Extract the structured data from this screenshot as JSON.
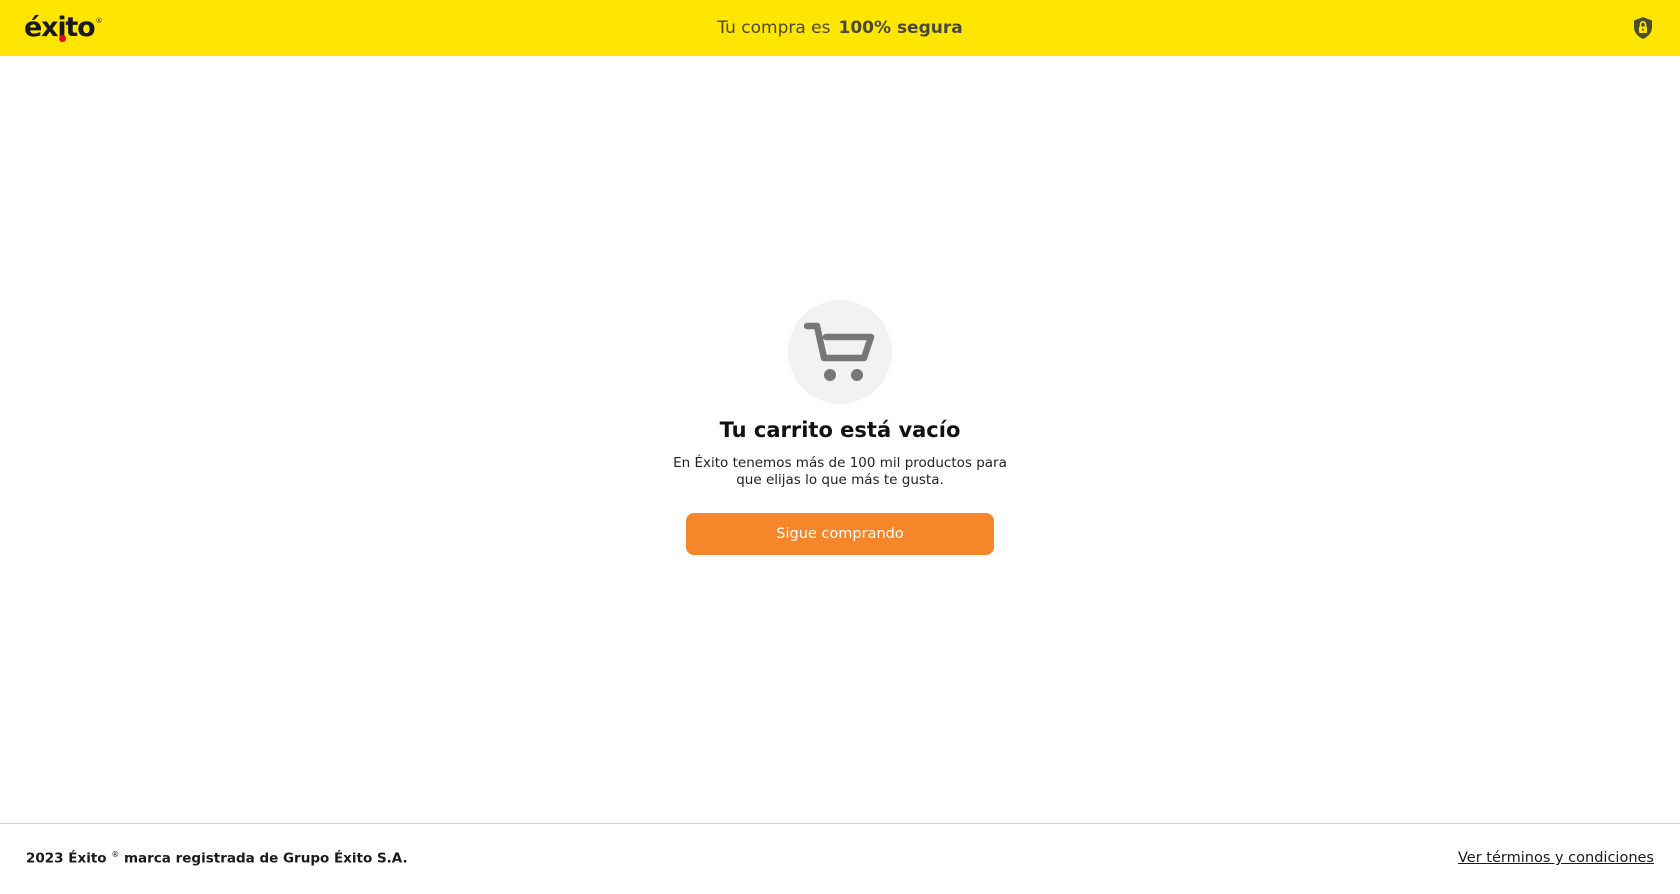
{
  "header": {
    "logo_text": "éxito",
    "logo_reg": "®",
    "secure_prefix": "Tu compra es",
    "secure_bold": "100% segura",
    "lock_icon": "lock-shield-icon"
  },
  "empty_cart": {
    "icon": "shopping-cart-icon",
    "title": "Tu carrito está vacío",
    "subtitle": "En Éxito tenemos más de 100 mil productos para que elijas lo que más te gusta.",
    "button_label": "Sigue comprando"
  },
  "footer": {
    "copyright_prefix": "2023 Éxito",
    "copyright_reg": "®",
    "copyright_suffix": "marca registrada de Grupo Éxito S.A.",
    "terms_link": "Ver términos y condiciones"
  },
  "colors": {
    "header_bg": "#ffe600",
    "cta_bg": "#f5862a",
    "logo_dot": "#e30613",
    "icon_gray": "#777777"
  }
}
